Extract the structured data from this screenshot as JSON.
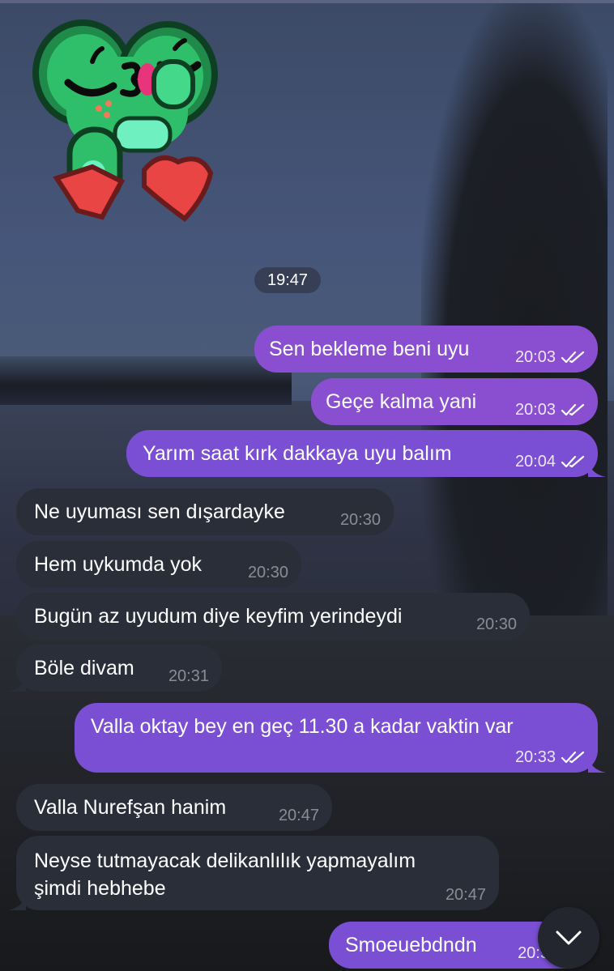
{
  "chat": {
    "date_separator": "19:47",
    "messages": [
      {
        "dir": "out",
        "text": "Sen bekleme beni uyu",
        "time": "20:03",
        "status": "read"
      },
      {
        "dir": "out",
        "text": "Geçe kalma yani",
        "time": "20:03",
        "status": "read"
      },
      {
        "dir": "out",
        "text": "Yarım saat kırk dakkaya uyu balım",
        "time": "20:04",
        "status": "read"
      },
      {
        "dir": "in",
        "text": "Ne uyuması sen dışardayke",
        "time": "20:30"
      },
      {
        "dir": "in",
        "text": "Hem uykumda yok",
        "time": "20:30"
      },
      {
        "dir": "in",
        "text": "Bugün az uyudum diye keyfim yerindeydi",
        "time": "20:30"
      },
      {
        "dir": "in",
        "text": "Böle divam",
        "time": "20:31"
      },
      {
        "dir": "out",
        "text": "Valla oktay bey en geç 11.30 a kadar vaktin var",
        "time": "20:33",
        "status": "read"
      },
      {
        "dir": "in",
        "text": "Valla Nurefşan hanim",
        "time": "20:47"
      },
      {
        "dir": "in",
        "text": "Neyse tutmayacak delikanlılık yapmayalım\nşimdi hebhebe",
        "line1": "Neyse tutmayacak delikanlılık yapmayalım",
        "line2": "şimdi hebhebe",
        "time": "20:47"
      },
      {
        "dir": "out",
        "text": "Smoeuebdndn",
        "time": "20:5"
      }
    ]
  },
  "sticker": {
    "icon": "kissing-heart-sticker"
  },
  "scroll_button": {
    "icon": "chevron-down-icon"
  },
  "colors": {
    "outgoing_bubble": "#7a4fd3",
    "incoming_bubble": "#2a2e38",
    "text": "#ffffff"
  }
}
